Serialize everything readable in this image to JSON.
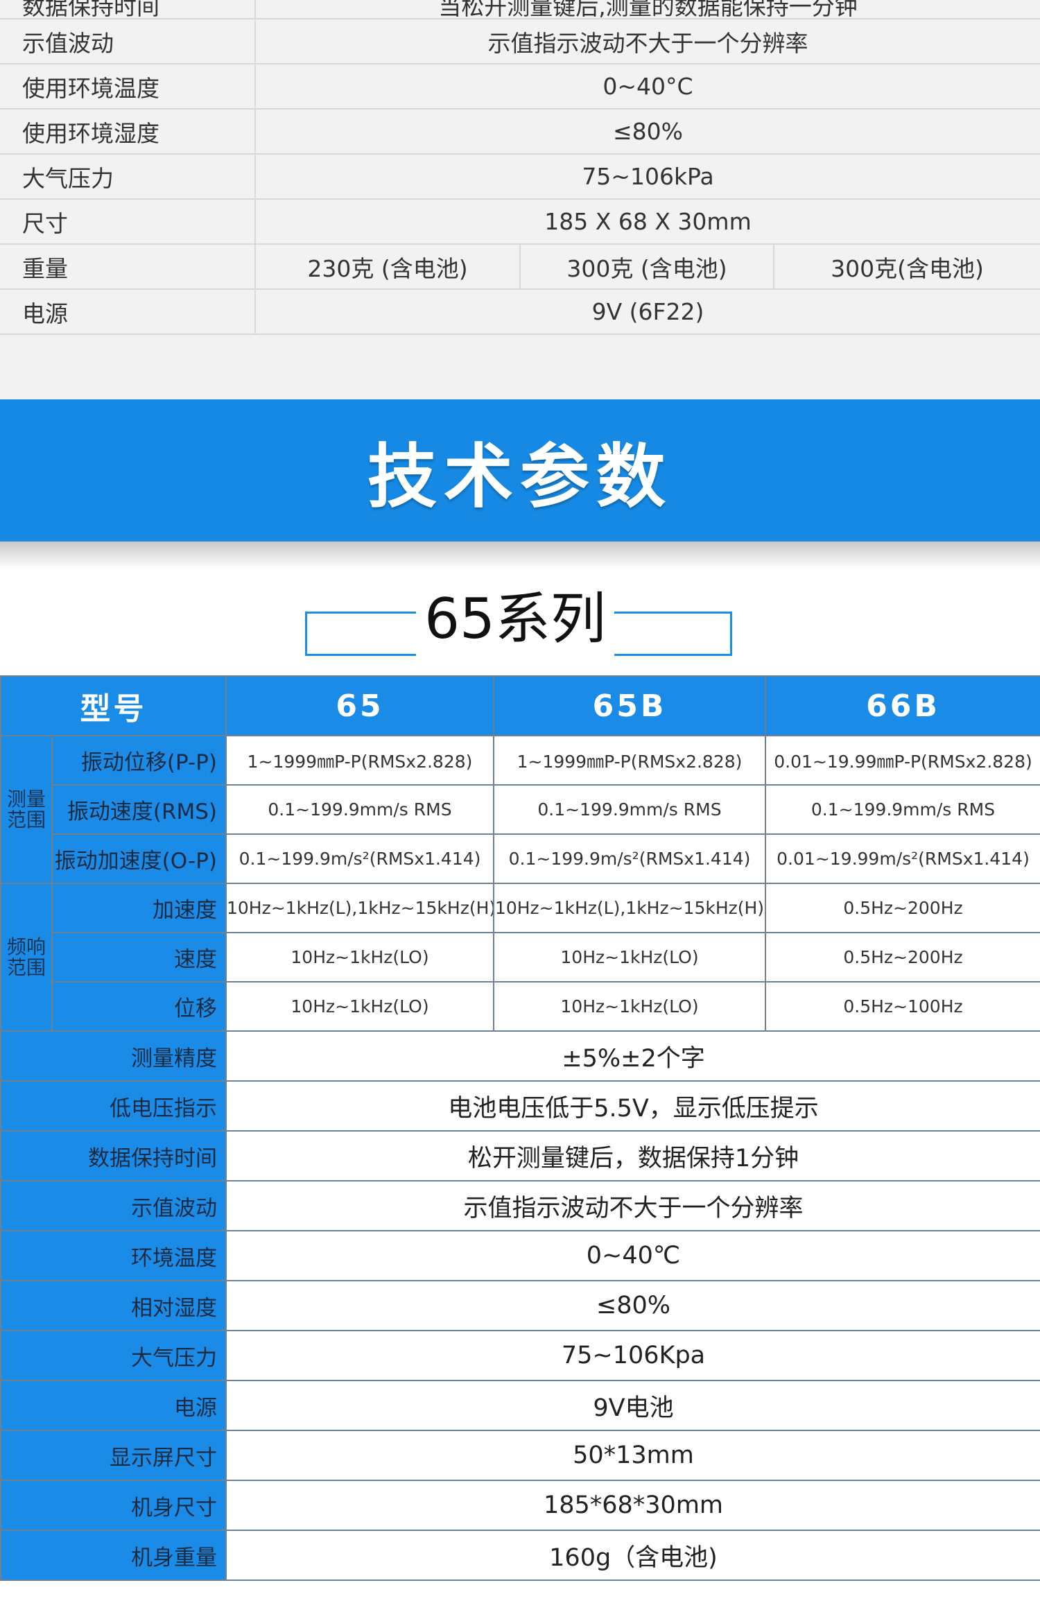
{
  "top_table": {
    "rows": [
      {
        "label": "数据保持时间",
        "value": "当松开测量键后,测量的数据能保持一分钟"
      },
      {
        "label": "示值波动",
        "value": "示值指示波动不大于一个分辨率"
      },
      {
        "label": "使用环境温度",
        "value": "0~40°C"
      },
      {
        "label": "使用环境湿度",
        "value": "≤80%"
      },
      {
        "label": "大气压力",
        "value": "75~106kPa"
      },
      {
        "label": "尺寸",
        "value": "185 X 68 X 30mm"
      }
    ],
    "weight": {
      "label": "重量",
      "values": [
        "230克 (含电池)",
        "300克 (含电池)",
        "300克(含电池)"
      ]
    },
    "power": {
      "label": "电源",
      "value": "9V (6F22)"
    }
  },
  "banner": {
    "title": "技术参数",
    "color": "#1589e3"
  },
  "series": {
    "title": "65系列"
  },
  "main_table": {
    "header": {
      "model_label": "型号",
      "models": [
        "65",
        "65B",
        "66B"
      ]
    },
    "measure_group": {
      "label": "测量范围",
      "rows": [
        {
          "label": "振动位移(P-P)",
          "values": [
            "1~1999㎜P-P(RMSx2.828)",
            "1~1999㎜P-P(RMSx2.828)",
            "0.01~19.99㎜P-P(RMSx2.828)"
          ]
        },
        {
          "label": "振动速度(RMS)",
          "values": [
            "0.1~199.9mm/s RMS",
            "0.1~199.9mm/s RMS",
            "0.1~199.9mm/s RMS"
          ]
        },
        {
          "label": "振动加速度(O-P)",
          "values": [
            "0.1~199.9m/s²(RMSx1.414)",
            "0.1~199.9m/s²(RMSx1.414)",
            "0.01~19.99m/s²(RMSx1.414)"
          ]
        }
      ]
    },
    "freq_group": {
      "label": "频响范围",
      "rows": [
        {
          "label": "加速度",
          "values": [
            "10Hz~1kHz(L),1kHz~15kHz(H)",
            "10Hz~1kHz(L),1kHz~15kHz(H)",
            "0.5Hz~200Hz"
          ]
        },
        {
          "label": "速度",
          "values": [
            "10Hz~1kHz(LO)",
            "10Hz~1kHz(LO)",
            "0.5Hz~200Hz"
          ]
        },
        {
          "label": "位移",
          "values": [
            "10Hz~1kHz(LO)",
            "10Hz~1kHz(LO)",
            "0.5Hz~100Hz"
          ]
        }
      ]
    },
    "general_rows": [
      {
        "label": "测量精度",
        "value": "±5%±2个字"
      },
      {
        "label": "低电压指示",
        "value": "电池电压低于5.5V，显示低压提示"
      },
      {
        "label": "数据保持时间",
        "value": "松开测量键后，数据保持1分钟"
      },
      {
        "label": "示值波动",
        "value": "示值指示波动不大于一个分辨率"
      },
      {
        "label": "环境温度",
        "value": "0~40℃"
      },
      {
        "label": "相对湿度",
        "value": "≤80%"
      },
      {
        "label": "大气压力",
        "value": "75~106Kpa"
      },
      {
        "label": "电源",
        "value": "9V电池"
      },
      {
        "label": "显示屏尺寸",
        "value": "50*13mm"
      },
      {
        "label": "机身尺寸",
        "value": "185*68*30mm"
      },
      {
        "label": "机身重量",
        "value": "160g（含电池)"
      }
    ]
  }
}
